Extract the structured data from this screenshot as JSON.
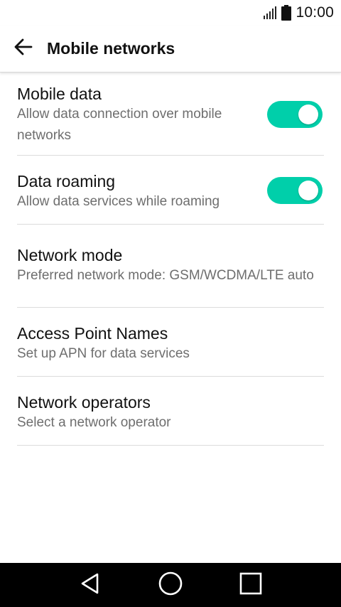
{
  "status_bar": {
    "time": "10:00",
    "signal_icon": "signal-icon",
    "battery_icon": "battery-icon"
  },
  "app_bar": {
    "title": "Mobile networks",
    "back_icon": "arrow-back-icon"
  },
  "colors": {
    "accent": "#00cfaa",
    "title_text": "#111111",
    "summary_text": "#6e6e6e",
    "divider": "#dcdcdc",
    "nav_bar": "#000000"
  },
  "settings": {
    "mobile_data": {
      "title": "Mobile data",
      "summary": "Allow data connection over mobile networks",
      "enabled": true
    },
    "data_roaming": {
      "title": "Data roaming",
      "summary": "Allow data services while roaming",
      "enabled": true
    },
    "network_mode": {
      "title": "Network mode",
      "summary": "Preferred network mode: GSM/WCDMA/LTE auto"
    },
    "access_point_names": {
      "title": "Access Point Names",
      "summary": "Set up APN for data services"
    },
    "network_operators": {
      "title": "Network operators",
      "summary": "Select a network operator"
    }
  },
  "nav_bar": {
    "back_icon": "nav-back-icon",
    "home_icon": "nav-home-icon",
    "recents_icon": "nav-recents-icon"
  }
}
